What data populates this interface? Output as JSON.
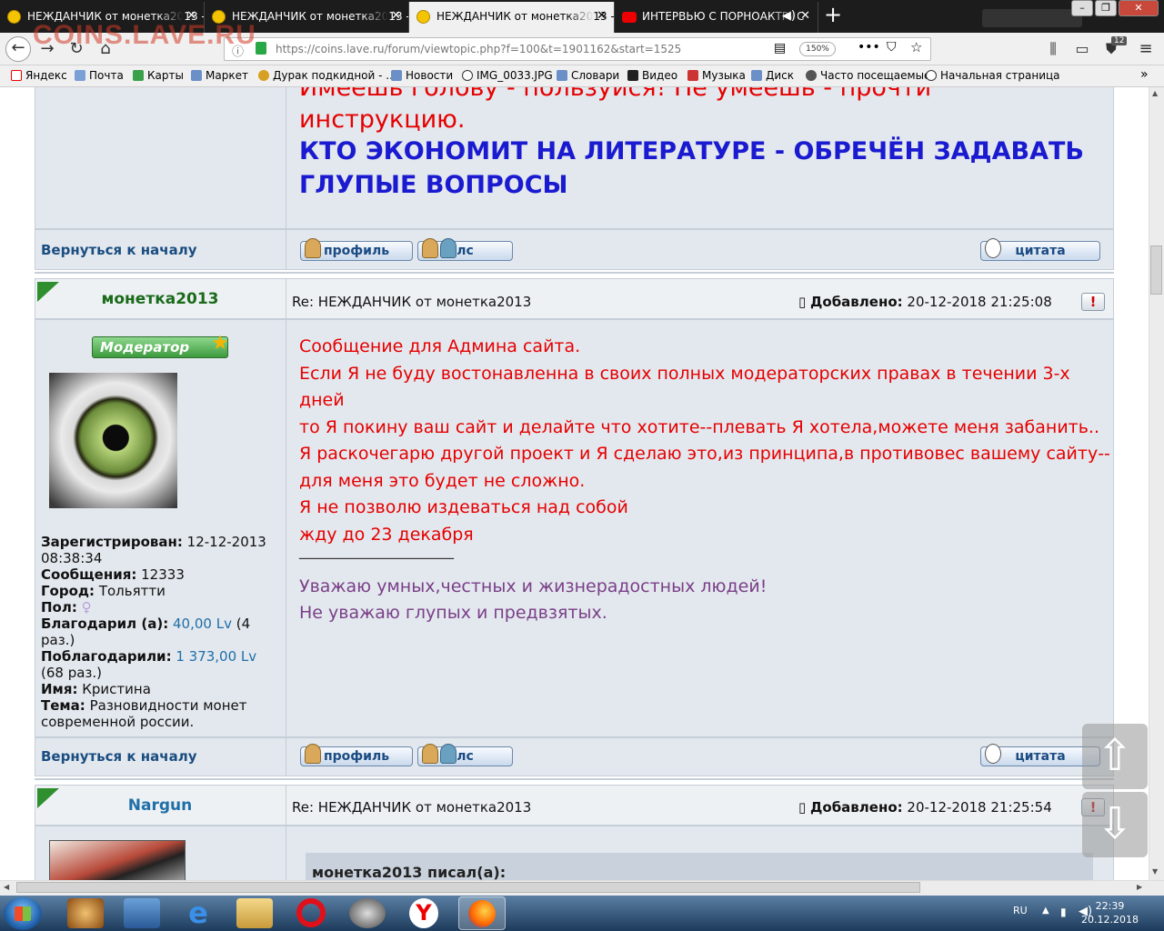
{
  "tabs": [
    {
      "title": "НЕЖДАНЧИК от монетка2013 -",
      "icon": "smiley-favicon",
      "active": false
    },
    {
      "title": "НЕЖДАНЧИК от монетка2013 -",
      "icon": "smiley-favicon",
      "active": false
    },
    {
      "title": "НЕЖДАНЧИК от монетка2013 -",
      "icon": "smiley-favicon",
      "active": true
    },
    {
      "title": "ИНТЕРВЬЮ С ПОРНОАКТРИС",
      "icon": "youtube-favicon",
      "active": false
    }
  ],
  "watermark": "COINS.LAVE.RU",
  "address": {
    "url": "https://coins.lave.ru/forum/viewtopic.php?f=100&t=1901162&start=1525",
    "zoom": "150%"
  },
  "toolbar": {
    "badge": "12"
  },
  "bookmarks": [
    "Яндекс",
    "Почта",
    "Карты",
    "Маркет",
    "Дурак подкидной - ...",
    "Новости",
    "IMG_0033.JPG",
    "Словари",
    "Видео",
    "Музыка",
    "Диск",
    "Часто посещаемые",
    "Начальная страница"
  ],
  "prev_post": {
    "line1": "Имеешь голову - пользуйся! Не умеешь - прочти",
    "line2": "инструкцию.",
    "line3": "КТО ЭКОНОМИТ НА ЛИТЕРАТУРЕ - ОБРЕЧЁН ЗАДАВАТЬ",
    "line4": "ГЛУПЫЕ ВОПРОСЫ",
    "back_link": "Вернуться к началу"
  },
  "buttons": {
    "profile": "профиль",
    "pm": "лс",
    "quote": "цитата"
  },
  "post1": {
    "username": "монетка2013",
    "rank": "Модератор",
    "title": "Re: НЕЖДАНЧИК от монетка2013",
    "date_label": "Добавлено:",
    "date": "20-12-2018 21:25:08",
    "report": "!",
    "message": [
      "Сообщение для Админа сайта.",
      "Если Я не буду востонавленна в своих полных модераторских правах в течении 3-х дней",
      "то Я покину ваш сайт и делайте что хотите--плевать Я хотела,можете меня забанить..",
      "Я раскочегарю другой проект и Я сделаю это,из принципа,в противовес вашему сайту--",
      "для меня это будет не сложно.",
      "Я не позволю издеваться над собой",
      "жду до 23 декабря"
    ],
    "sig_rule": "____________________",
    "signature": [
      "Уважаю умных,честных и жизнерадостных людей!",
      "Не уважаю глупых и предвзятых."
    ],
    "info": {
      "registered_label": "Зарегистрирован:",
      "registered": "12-12-2013 08:38:34",
      "posts_label": "Сообщения:",
      "posts": "12333",
      "city_label": "Город:",
      "city": "Тольятти",
      "gender_label": "Пол:",
      "thanked_label": "Благодарил (а):",
      "thanked_amount": "40,00 Lv",
      "thanked_count": "(4 раз.)",
      "was_thanked_label": "Поблагодарили:",
      "was_thanked_amount": "1 373,00 Lv",
      "was_thanked_count": "(68 раз.)",
      "name_label": "Имя:",
      "name": "Кристина",
      "theme_label": "Тема:",
      "theme": "Разновидности монет современной россии."
    },
    "back_link": "Вернуться к началу"
  },
  "post2": {
    "username": "Nargun",
    "title": "Re: НЕЖДАНЧИК от монетка2013",
    "date_label": "Добавлено:",
    "date": "20-12-2018 21:25:54",
    "report": "!",
    "quote_header": "монетка2013 писал(а):"
  },
  "taskbar": {
    "lang": "RU",
    "time": "22:39",
    "date": "20.12.2018"
  },
  "colors": {
    "red_text": "#e60000",
    "blue_text": "#1a1ad0",
    "sig": "#7a3f88",
    "panel": "#e3e8ee",
    "green_name": "#1a6b1a",
    "blue_name": "#1f6fa8"
  }
}
